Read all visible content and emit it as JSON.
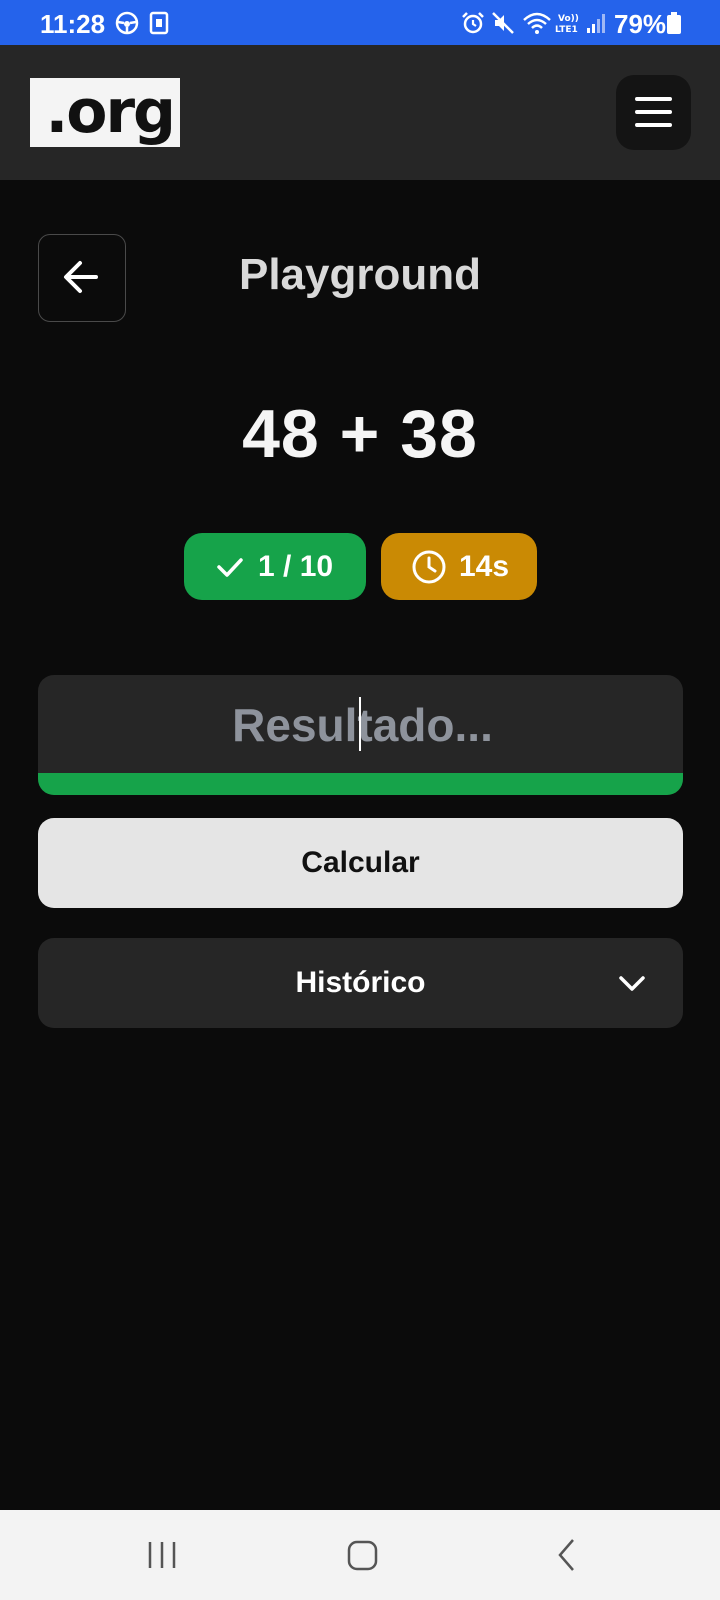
{
  "status_bar": {
    "time": "11:28",
    "battery": "79%",
    "icons": [
      "steering-wheel-icon",
      "sim-card-icon",
      "alarm-icon",
      "mute-icon",
      "wifi-icon",
      "volte-icon",
      "signal-icon",
      "battery-icon"
    ]
  },
  "header": {
    "logo_text": ".org",
    "menu_icon": "hamburger-icon"
  },
  "page": {
    "title": "Playground",
    "back_icon": "arrow-left-icon"
  },
  "exercise": {
    "expression": "48 + 38"
  },
  "stats": {
    "score_icon": "check-icon",
    "score": "1 / 10",
    "timer_icon": "clock-icon",
    "timer": "14s"
  },
  "result_input": {
    "value": "",
    "placeholder": "Resultado..."
  },
  "actions": {
    "calculate_label": "Calcular"
  },
  "history": {
    "label": "Histórico",
    "icon": "chevron-down-icon"
  },
  "colors": {
    "status_bar": "#2563eb",
    "success": "#16a34a",
    "warning": "#ca8a04",
    "background": "#0b0b0b",
    "surface": "#262626"
  },
  "nav_bar": {
    "items": [
      "recent-apps-icon",
      "home-icon",
      "back-icon"
    ]
  }
}
